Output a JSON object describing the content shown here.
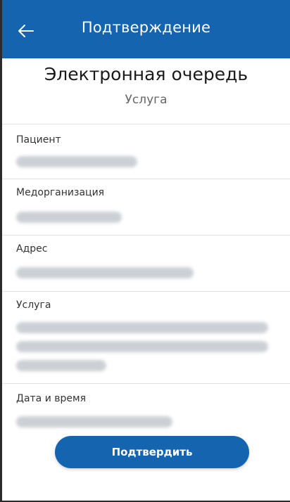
{
  "header": {
    "title": "Подтверждение",
    "back_icon": "arrow-left"
  },
  "main": {
    "heading": "Электронная очередь",
    "subheading": "Услуга",
    "fields": [
      {
        "label": "Пациент"
      },
      {
        "label": "Медорганизация"
      },
      {
        "label": "Адрес"
      },
      {
        "label": "Услуга"
      },
      {
        "label": "Дата и время"
      }
    ],
    "confirm_label": "Подтвердить"
  },
  "colors": {
    "accent": "#1564b0",
    "background": "#ffffff",
    "blurred_text": "#c7ccd2"
  }
}
